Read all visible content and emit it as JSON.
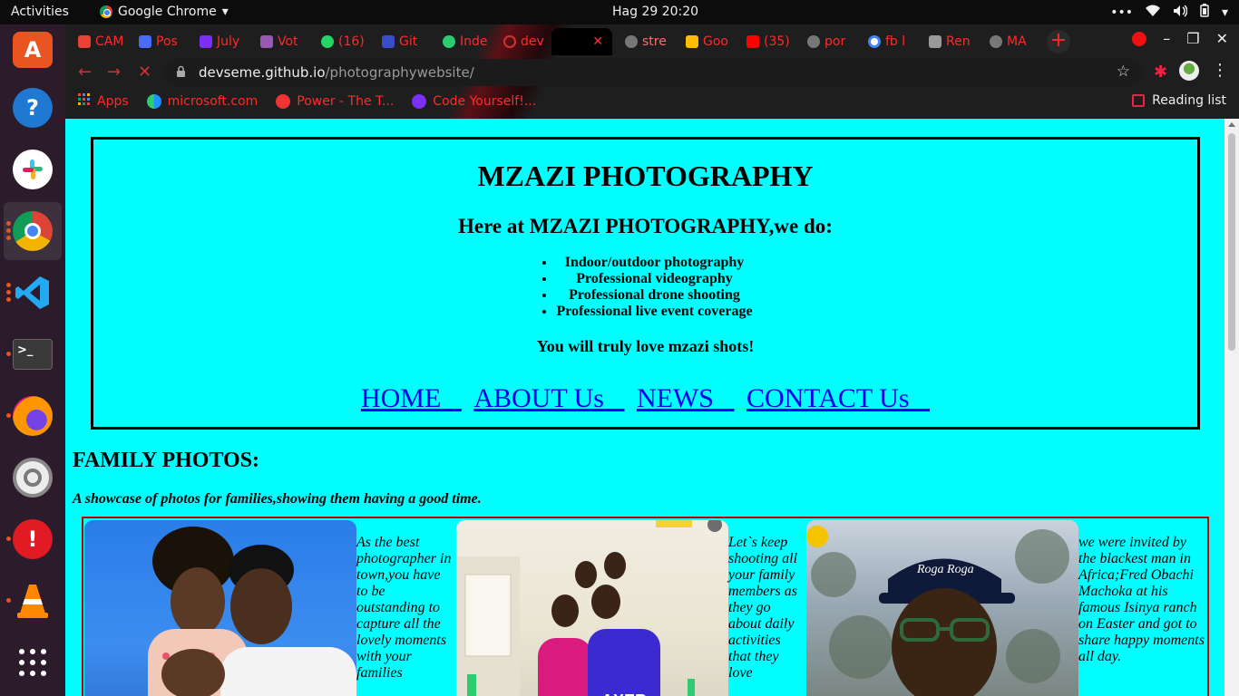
{
  "topbar": {
    "activities": "Activities",
    "app_name": "Google Chrome",
    "clock": "Hag 29  20:20"
  },
  "dock": {
    "items": [
      "ubuntu-software",
      "help",
      "slack",
      "chrome",
      "vscode",
      "terminal",
      "firefox",
      "settings",
      "error-reporter",
      "vlc",
      "show-apps"
    ]
  },
  "browser": {
    "tabs": [
      {
        "label": "CAM",
        "color": "#ea4335"
      },
      {
        "label": "Pos",
        "color": "#4a6cf7"
      },
      {
        "label": "July",
        "color": "#7b2ff7"
      },
      {
        "label": "Vot",
        "color": "#9b59b6"
      },
      {
        "label": "(16)",
        "color": "#25d366"
      },
      {
        "label": "Git",
        "color": "#3b4cca"
      },
      {
        "label": "Inde",
        "color": "#2ecc71"
      },
      {
        "label": "dev",
        "color": "#555555"
      },
      {
        "label": "",
        "color": "#ff2a2a"
      },
      {
        "label": "stre",
        "color": "#777777"
      },
      {
        "label": "Goo",
        "color": "#fbbc05"
      },
      {
        "label": "(35)",
        "color": "#ff0000"
      },
      {
        "label": "por",
        "color": "#777777"
      },
      {
        "label": "fb l",
        "color": "#4285f4"
      },
      {
        "label": "Ren",
        "color": "#999999"
      },
      {
        "label": "MA",
        "color": "#777777"
      }
    ],
    "url_host": "devseme.github.io",
    "url_path": "/photographywebsite/",
    "bookmarks": [
      {
        "label": "Apps",
        "color": "#ff2a2a"
      },
      {
        "label": "microsoft.com",
        "color": "#1e90ff"
      },
      {
        "label": "Power - The T...",
        "color": "#e33"
      },
      {
        "label": "Code Yourself!...",
        "color": "#7b2ff7"
      }
    ],
    "reading_list": "Reading list"
  },
  "page": {
    "title": "MZAZI PHOTOGRAPHY",
    "subtitle": "Here at MZAZI PHOTOGRAPHY,we do:",
    "services": [
      "Indoor/outdoor photography",
      "Professional videography",
      "Professional drone shooting",
      "Professional live event coverage"
    ],
    "tagline": "You will truly love mzazi shots!",
    "nav": [
      "HOME",
      "ABOUT Us",
      "NEWS",
      "CONTACT Us"
    ],
    "section_title": "FAMILY PHOTOS:",
    "section_subtitle": "A showcase of photos for families,showing them having a good time.",
    "captions": [
      "As the best photographer in town,you have to be outstanding to capture all the lovely moments with your families",
      "Let`s keep shooting all your family members as they go about daily activities that they love",
      "we were invited by the blackest man in Africa;Fred Obachi Machoka at his famous Isinya ranch on Easter and got to share happy moments all day."
    ],
    "photo3_cap_text": "Roga Roga"
  }
}
